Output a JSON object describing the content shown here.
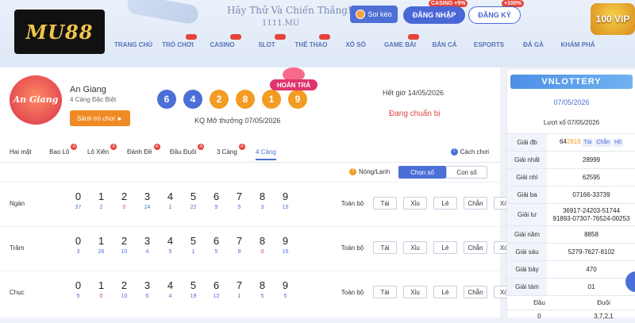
{
  "header": {
    "logo": "MU88",
    "slogan": "Hãy Thử Và Chiến Thắng!",
    "domain": "1111.MU",
    "soikeo_label": "Soi kèo",
    "login_label": "ĐĂNG NHẬP",
    "register_label": "ĐĂNG KÝ",
    "casino_badge": "CASINO +5%",
    "bonus_badge": "+100%",
    "vip_label": "100 VIP"
  },
  "nav": [
    "TRANG CHỦ",
    "TRÒ CHƠI",
    "CASINO",
    "SLOT",
    "THỂ THAO",
    "XỔ SỐ",
    "GAME BÀI",
    "BẮN CÁ",
    "ESPORTS",
    "ĐÁ GÀ",
    "KHÁM PHÁ"
  ],
  "game": {
    "province_badge": "An Giang",
    "province": "An Giang",
    "subtitle": "4 Càng Đặc Biệt",
    "lobby_button": "Sảnh trò chơi ►",
    "balls": [
      "6",
      "4",
      "2",
      "8",
      "1",
      "9"
    ],
    "hoantra": "HOÀN TRẢ",
    "result_date": "KQ Mở thưởng 07/05/2026",
    "deadline": "Hết giờ 14/05/2026",
    "status": "Đang chuẩn bị"
  },
  "tabs": [
    "Hai mặt",
    "Bao Lô",
    "Lô Xiên",
    "Đánh Đề",
    "Đầu Đuôi",
    "3 Càng",
    "4 Càng"
  ],
  "tab_marks": [
    "A",
    "A",
    "A",
    "A",
    "A"
  ],
  "how_to_play": "Cách chơi",
  "mode": {
    "hot_cold": "Nóng/Lạnh",
    "choose_number": "Chọn số",
    "con_so": "Con số",
    "info": "i",
    "question": "?"
  },
  "rows": [
    {
      "label": "Ngàn",
      "digits": [
        "0",
        "1",
        "2",
        "3",
        "4",
        "5",
        "6",
        "7",
        "8",
        "9"
      ],
      "counts": [
        "37",
        "2",
        "0",
        "24",
        "1",
        "22",
        "9",
        "5",
        "3",
        "15"
      ]
    },
    {
      "label": "Trăm",
      "digits": [
        "0",
        "1",
        "2",
        "3",
        "4",
        "5",
        "6",
        "7",
        "8",
        "9"
      ],
      "counts": [
        "3",
        "26",
        "10",
        "4",
        "5",
        "1",
        "5",
        "8",
        "0",
        "16"
      ]
    },
    {
      "label": "Chục",
      "digits": [
        "0",
        "1",
        "2",
        "3",
        "4",
        "5",
        "6",
        "7",
        "8",
        "9"
      ],
      "counts": [
        "5",
        "0",
        "10",
        "6",
        "4",
        "19",
        "12",
        "1",
        "5",
        "5"
      ]
    }
  ],
  "row_buttons": [
    "Toàn bộ",
    "Tài",
    "Xỉu",
    "Lẻ",
    "Chẵn",
    "Xóa"
  ],
  "side": {
    "brand": "VNLOTTERY",
    "date": "07/05/2026",
    "draw_label": "Lượt xổ 07/05/2026",
    "results": [
      {
        "label": "Giải đb",
        "value": "642819"
      },
      {
        "label": "Giải nhất",
        "value": "28999"
      },
      {
        "label": "Giải nhì",
        "value": "62595"
      },
      {
        "label": "Giải ba",
        "value": "07166-33739"
      },
      {
        "label": "Giải tư",
        "value": "36917-24203-51744 91893-07307-76524-00253"
      },
      {
        "label": "Giải năm",
        "value": "8858"
      },
      {
        "label": "Giải sáu",
        "value": "5279-7627-8102"
      },
      {
        "label": "Giải bảy",
        "value": "470"
      },
      {
        "label": "Giải tám",
        "value": "01"
      }
    ],
    "db_prefix": "64",
    "db_highlight": "2819",
    "db_tags": [
      "Tài",
      "Chẵn",
      "Hồ"
    ],
    "giai_tu_line1": "36917-24203-51744",
    "giai_tu_line2": "91893-07307-76524-00253",
    "dd_head": [
      "Đầu",
      "Đuôi"
    ],
    "dd_row": [
      "0",
      "3,7,2,1"
    ]
  }
}
